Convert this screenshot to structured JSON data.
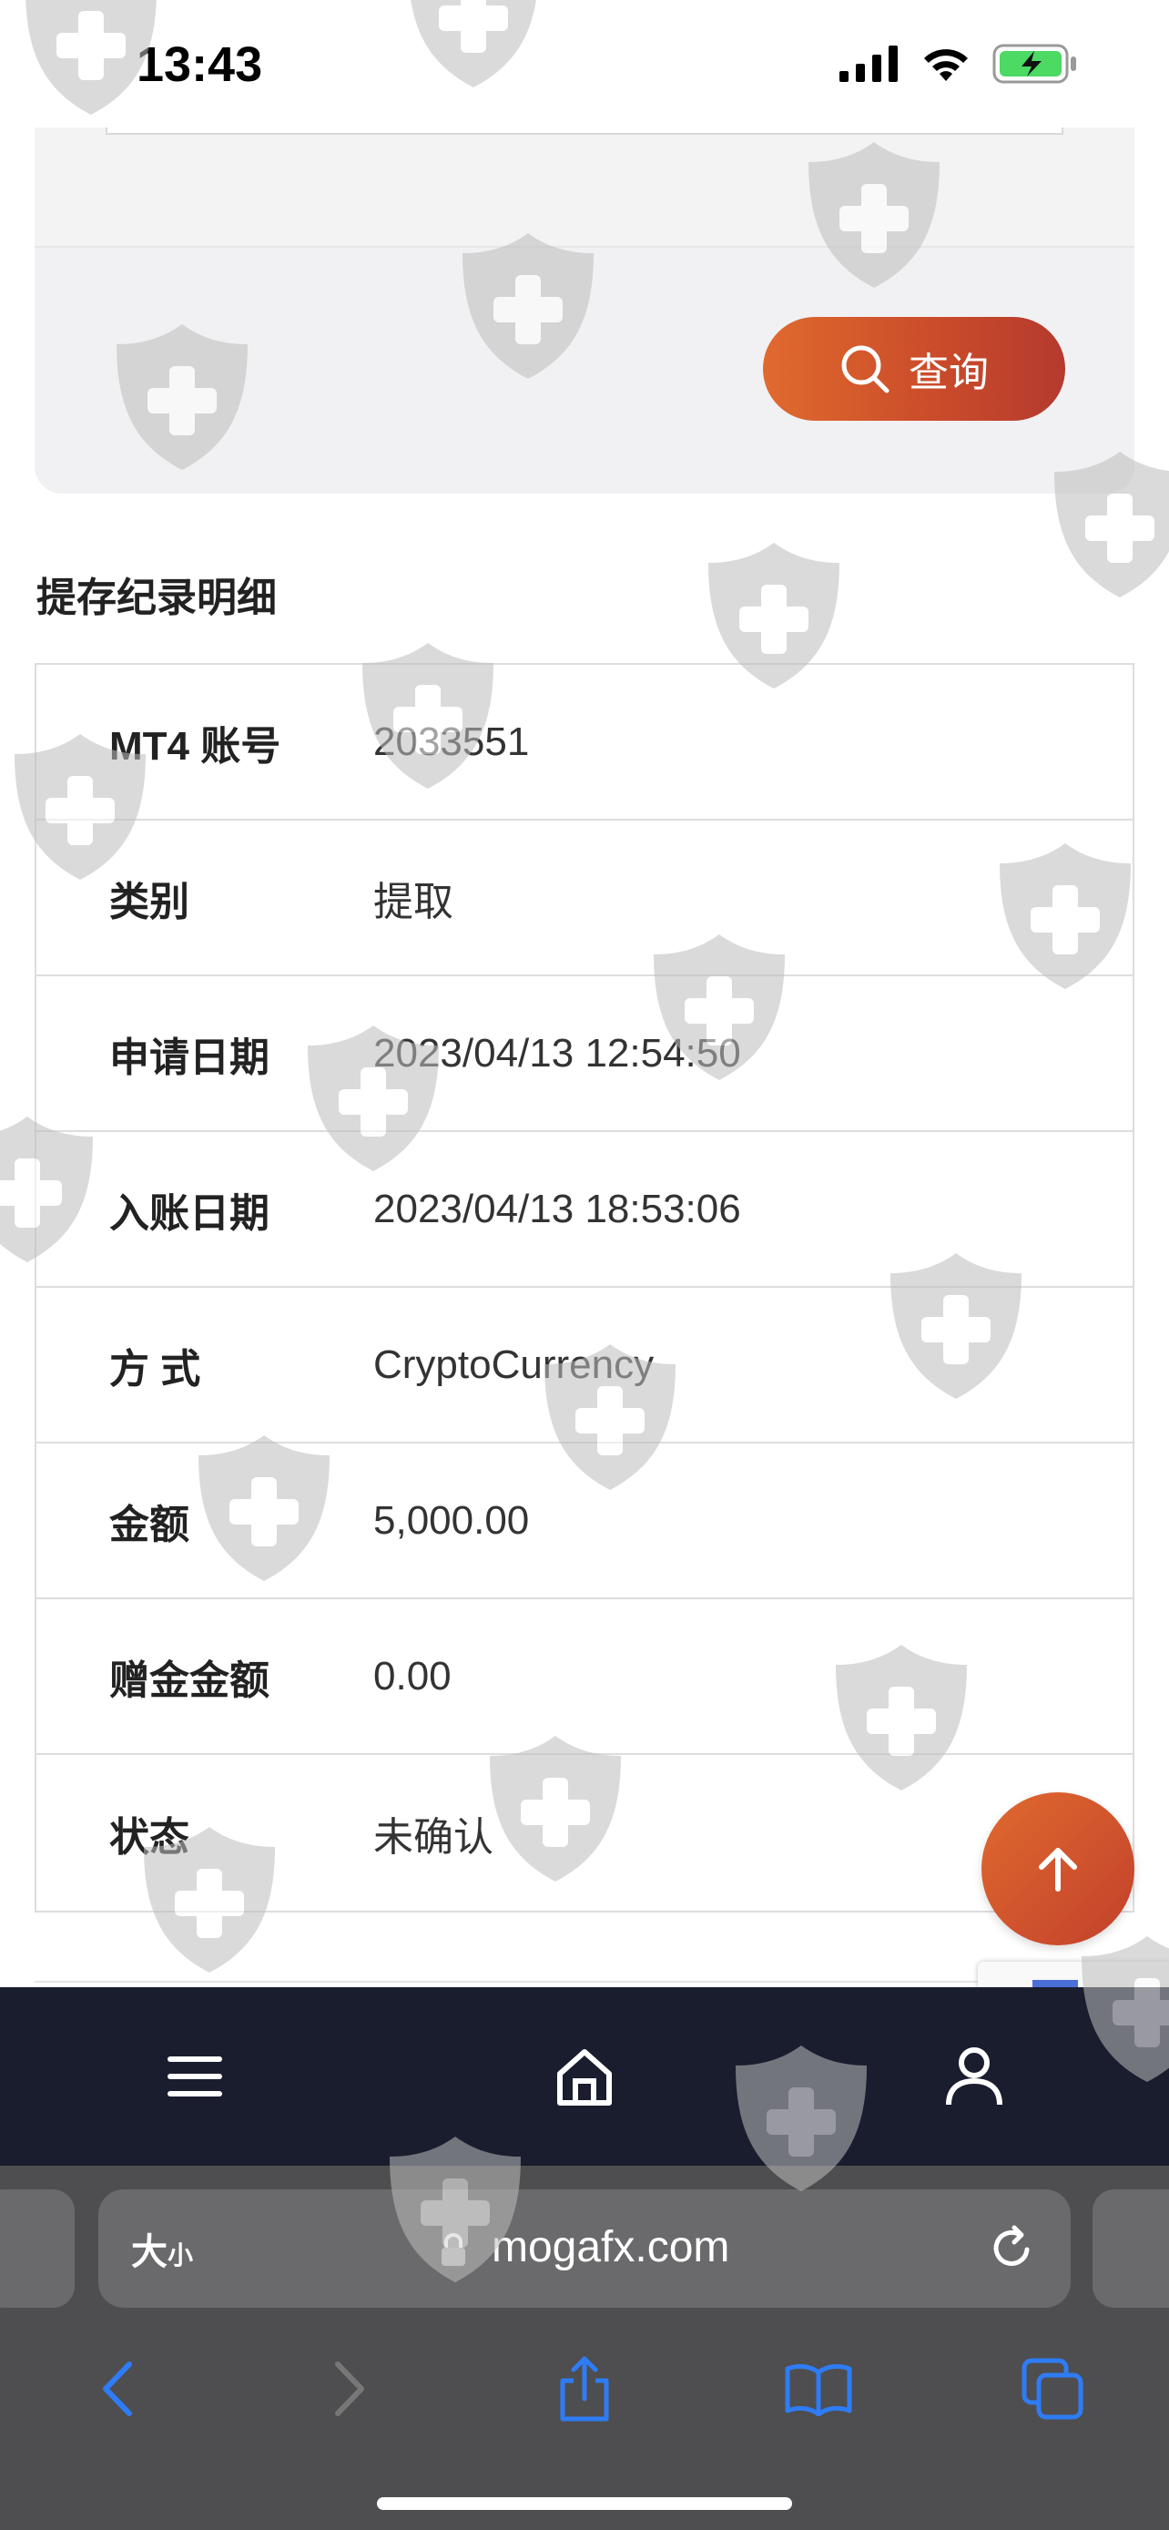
{
  "status_bar": {
    "time": "13:43"
  },
  "search": {
    "query_label": "查询"
  },
  "section": {
    "title": "提存纪录明细"
  },
  "details": {
    "rows": [
      {
        "label": "MT4 账号",
        "value": "2033551"
      },
      {
        "label": "类别",
        "value": "提取"
      },
      {
        "label": "申请日期",
        "value": "2023/04/13 12:54:50"
      },
      {
        "label": "入账日期",
        "value": "2023/04/13 18:53:06"
      },
      {
        "label": "方 式",
        "value": "CryptoCurrency"
      },
      {
        "label": "金额",
        "value": "5,000.00"
      },
      {
        "label": "赠金金额",
        "value": "0.00"
      },
      {
        "label": "状态",
        "value": "未确认"
      }
    ]
  },
  "app_nav": {
    "items": [
      "menu-icon",
      "home-icon",
      "user-icon"
    ]
  },
  "safari": {
    "text_size_label": "大",
    "text_size_small": "小",
    "url": "mogafx.com"
  },
  "colors": {
    "accent_start": "#e06a2e",
    "accent_end": "#b53a2e",
    "nav_bg": "#1a1d2e"
  }
}
